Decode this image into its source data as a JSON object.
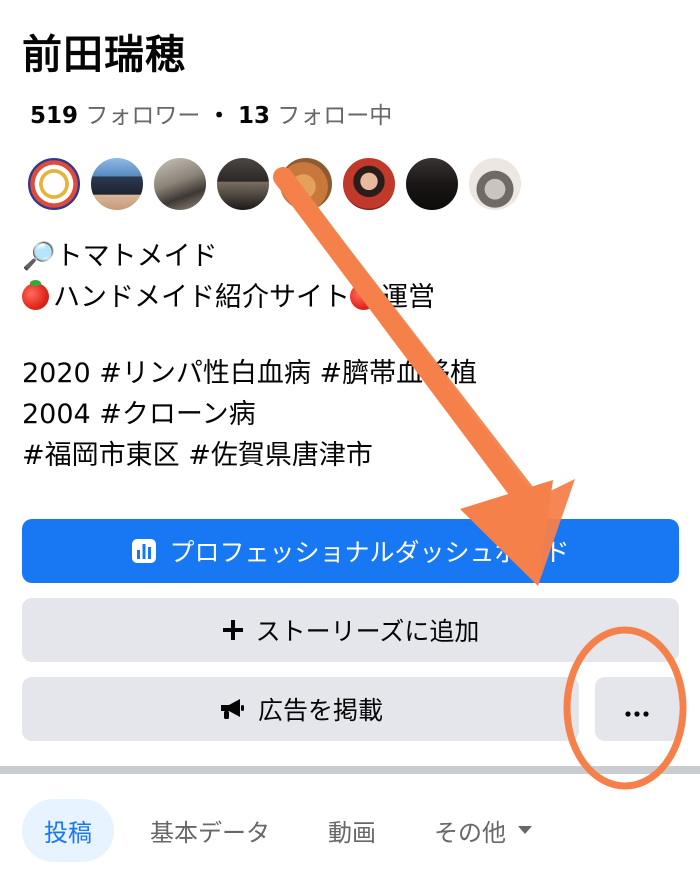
{
  "profile": {
    "name": "前田瑞穂",
    "followers_count": "519",
    "followers_label": "フォロワー",
    "separator": "・",
    "following_count": "13",
    "following_label": "フォロー中"
  },
  "bio": {
    "line1": "🔎トマトメイド",
    "line2": "ハンドメイド紹介サイト",
    "line2_suffix": "運営",
    "line3": "2020 #リンパ性白血病 #臍帯血移植",
    "line4": "2004 #クローン病",
    "line5": "#福岡市東区  #佐賀県唐津市"
  },
  "buttons": {
    "dashboard": "プロフェッショナルダッシュボード",
    "add_story": "ストーリーズに追加",
    "advertise": "広告を掲載",
    "more": "···"
  },
  "tabs": [
    {
      "label": "投稿"
    },
    {
      "label": "基本データ"
    },
    {
      "label": "動画"
    },
    {
      "label": "その他"
    }
  ],
  "colors": {
    "primary": "#1877f2",
    "secondary_button": "#e4e6eb",
    "annotation": "#f5804a",
    "tab_active_bg": "#e7f3ff"
  },
  "icons": {
    "dashboard": "bar-chart-icon",
    "add_story": "plus-icon",
    "advertise": "megaphone-icon",
    "more": "ellipsis-icon",
    "tab_more": "caret-down-icon"
  }
}
